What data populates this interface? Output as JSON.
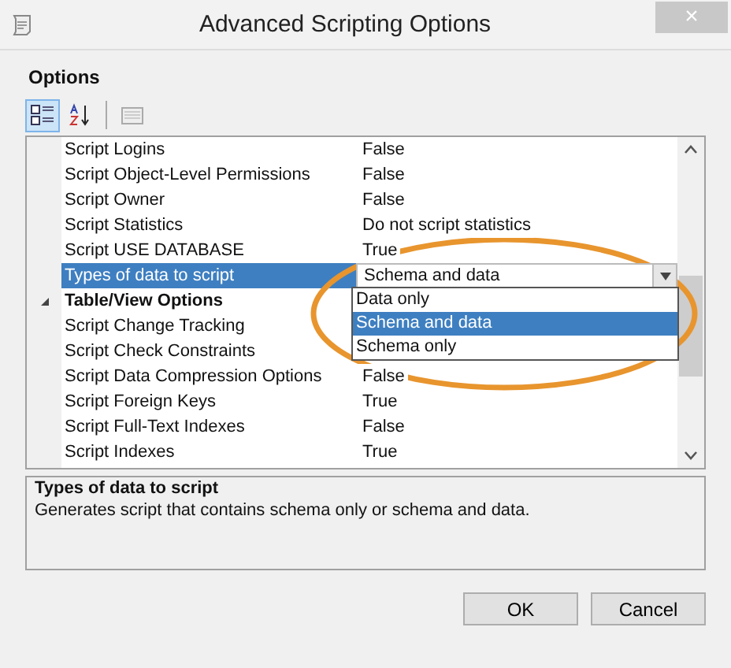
{
  "window": {
    "title": "Advanced Scripting Options",
    "close": "×"
  },
  "section_title": "Options",
  "toolbar": [
    {
      "kind": "categorized",
      "selected": true
    },
    {
      "kind": "alphabetical",
      "selected": false
    },
    {
      "kind": "pages",
      "selected": false
    }
  ],
  "grid": {
    "rows": [
      {
        "kind": "property",
        "name": "Script Logins",
        "value": "False",
        "selected": false
      },
      {
        "kind": "property",
        "name": "Script Object-Level Permissions",
        "value": "False",
        "selected": false
      },
      {
        "kind": "property",
        "name": "Script Owner",
        "value": "False",
        "selected": false
      },
      {
        "kind": "property",
        "name": "Script Statistics",
        "value": "Do not script statistics",
        "selected": false
      },
      {
        "kind": "property",
        "name": "Script USE DATABASE",
        "value": "True",
        "selected": false
      },
      {
        "kind": "property",
        "name": "Types of data to script",
        "value": "Schema and data",
        "selected": true
      },
      {
        "kind": "category",
        "name": "Table/View Options",
        "expanded": true
      },
      {
        "kind": "property",
        "name": "Script Change Tracking",
        "selected": false
      },
      {
        "kind": "property",
        "name": "Script Check Constraints",
        "selected": false
      },
      {
        "kind": "property",
        "name": "Script Data Compression Options",
        "value": "False",
        "selected": false
      },
      {
        "kind": "property",
        "name": "Script Foreign Keys",
        "value": "True",
        "selected": false
      },
      {
        "kind": "property",
        "name": "Script Full-Text Indexes",
        "value": "False",
        "selected": false
      },
      {
        "kind": "property",
        "name": "Script Indexes",
        "value": "True",
        "selected": false
      }
    ],
    "dropdown_options": [
      {
        "label": "Data only",
        "selected": false
      },
      {
        "label": "Schema and data",
        "selected": true
      },
      {
        "label": "Schema only",
        "selected": false
      }
    ]
  },
  "description": {
    "title": "Types of data to script",
    "text": "Generates script that contains schema only or schema and data."
  },
  "buttons": [
    "OK",
    "Cancel"
  ]
}
